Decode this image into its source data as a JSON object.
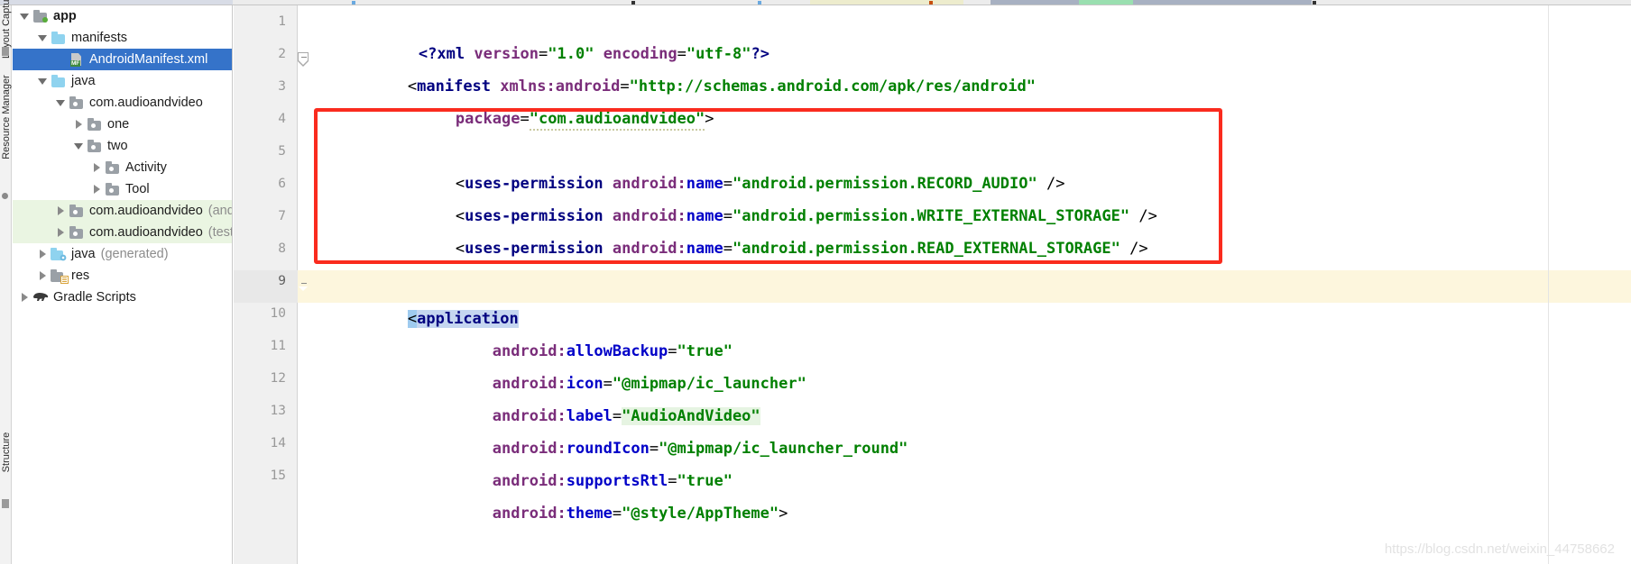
{
  "window": {
    "watermark": "https://blog.csdn.net/weixin_44758662"
  },
  "left_rail": {
    "items": [
      {
        "label": "Layout Captures",
        "name": "rail-item-1"
      },
      {
        "label": "Resource Manager",
        "name": "rail-item-resource-manager"
      },
      {
        "label": "Structure",
        "name": "rail-item-structure"
      }
    ]
  },
  "project_tree": {
    "items": [
      {
        "label": "app",
        "suffix": "",
        "icon": "module-folder-icon",
        "indent": 0,
        "twisty": "down",
        "selected": false,
        "bold": true,
        "greenbg": false
      },
      {
        "label": "manifests",
        "suffix": "",
        "icon": "folder-icon",
        "indent": 1,
        "twisty": "down",
        "selected": false,
        "bold": false,
        "greenbg": false
      },
      {
        "label": "AndroidManifest.xml",
        "suffix": "",
        "icon": "manifest-file-icon",
        "indent": 2,
        "twisty": "none",
        "selected": true,
        "bold": false,
        "greenbg": false
      },
      {
        "label": "java",
        "suffix": "",
        "icon": "folder-icon",
        "indent": 1,
        "twisty": "down",
        "selected": false,
        "bold": false,
        "greenbg": false
      },
      {
        "label": "com.audioandvideo",
        "suffix": "",
        "icon": "package-icon",
        "indent": 2,
        "twisty": "down",
        "selected": false,
        "bold": false,
        "greenbg": false
      },
      {
        "label": "one",
        "suffix": "",
        "icon": "package-icon",
        "indent": 3,
        "twisty": "right",
        "selected": false,
        "bold": false,
        "greenbg": false
      },
      {
        "label": "two",
        "suffix": "",
        "icon": "package-icon",
        "indent": 3,
        "twisty": "down",
        "selected": false,
        "bold": false,
        "greenbg": false
      },
      {
        "label": "Activity",
        "suffix": "",
        "icon": "package-icon",
        "indent": 4,
        "twisty": "right",
        "selected": false,
        "bold": false,
        "greenbg": false
      },
      {
        "label": "Tool",
        "suffix": "",
        "icon": "package-icon",
        "indent": 4,
        "twisty": "right",
        "selected": false,
        "bold": false,
        "greenbg": false
      },
      {
        "label": "com.audioandvideo",
        "suffix": "(andro",
        "icon": "package-icon",
        "indent": 2,
        "twisty": "right",
        "selected": false,
        "bold": false,
        "greenbg": true
      },
      {
        "label": "com.audioandvideo",
        "suffix": "(test)",
        "icon": "package-icon",
        "indent": 2,
        "twisty": "right",
        "selected": false,
        "bold": false,
        "greenbg": true
      },
      {
        "label": "java",
        "suffix": "(generated)",
        "icon": "generated-folder-icon",
        "indent": 1,
        "twisty": "right",
        "selected": false,
        "bold": false,
        "greenbg": false
      },
      {
        "label": "res",
        "suffix": "",
        "icon": "res-folder-icon",
        "indent": 1,
        "twisty": "right",
        "selected": false,
        "bold": false,
        "greenbg": false
      },
      {
        "label": "Gradle Scripts",
        "suffix": "",
        "icon": "gradle-elephant-icon",
        "indent": 0,
        "twisty": "right",
        "selected": false,
        "bold": false,
        "greenbg": false
      }
    ]
  },
  "editor": {
    "file": "AndroidManifest.xml",
    "line_numbers": [
      "1",
      "2",
      "3",
      "4",
      "5",
      "6",
      "7",
      "8",
      "9",
      "10",
      "11",
      "12",
      "13",
      "14",
      "15"
    ],
    "current_line": "9",
    "lines": [
      {
        "num": "1",
        "text": "<?xml version=\"1.0\" encoding=\"utf-8\"?>"
      },
      {
        "num": "2",
        "text": "<manifest xmlns:android=\"http://schemas.android.com/apk/res/android\""
      },
      {
        "num": "3",
        "text": "    package=\"com.audioandvideo\">"
      },
      {
        "num": "4",
        "text": ""
      },
      {
        "num": "5",
        "text": "    <uses-permission android:name=\"android.permission.RECORD_AUDIO\" />"
      },
      {
        "num": "6",
        "text": "    <uses-permission android:name=\"android.permission.WRITE_EXTERNAL_STORAGE\" />"
      },
      {
        "num": "7",
        "text": "    <uses-permission android:name=\"android.permission.READ_EXTERNAL_STORAGE\" />"
      },
      {
        "num": "8",
        "text": ""
      },
      {
        "num": "9",
        "text": "<application"
      },
      {
        "num": "10",
        "text": "        android:allowBackup=\"true\""
      },
      {
        "num": "11",
        "text": "        android:icon=\"@mipmap/ic_launcher\""
      },
      {
        "num": "12",
        "text": "        android:label=\"AudioAndVideo\""
      },
      {
        "num": "13",
        "text": "        android:roundIcon=\"@mipmap/ic_launcher_round\""
      },
      {
        "num": "14",
        "text": "        android:supportsRtl=\"true\""
      },
      {
        "num": "15",
        "text": "        android:theme=\"@style/AppTheme\">"
      }
    ],
    "tokens": {
      "l1_open": "<?",
      "l1_name": "xml",
      "l1_attr1": "version",
      "l1_eq": "=",
      "l1_val1": "\"1.0\"",
      "l1_attr2": "encoding",
      "l1_val2": "\"utf-8\"",
      "l1_close": "?>",
      "l2_lt": "<",
      "l2_tag": "manifest",
      "l2_attr": "xmlns:android",
      "l2_eq": "=",
      "l2_val": "\"http://schemas.android.com/apk/res/android\"",
      "l3_attr": "package",
      "l3_eq": "=",
      "l3_val": "\"com.audioandvideo\"",
      "l3_gt": ">",
      "perm_lt": "<",
      "perm_tag": "uses-permission",
      "perm_ns": "android",
      "perm_colon": ":",
      "perm_attr": "name",
      "perm_eq": "=",
      "perm_end": "/>",
      "perm1_val": "\"android.permission.RECORD_AUDIO\"",
      "perm2_val": "\"android.permission.WRITE_EXTERNAL_STORAGE\"",
      "perm3_val": "\"android.permission.READ_EXTERNAL_STORAGE\"",
      "app_lt": "<",
      "app_tag": "application",
      "a_ns": "android",
      "a_colon": ":",
      "a_eq": "=",
      "a10_name": "allowBackup",
      "a10_val": "\"true\"",
      "a11_name": "icon",
      "a11_val": "\"@mipmap/ic_launcher\"",
      "a12_name": "label",
      "a12_val": "\"AudioAndVideo\"",
      "a13_name": "roundIcon",
      "a13_val": "\"@mipmap/ic_launcher_round\"",
      "a14_name": "supportsRtl",
      "a14_val": "\"true\"",
      "a15_name": "theme",
      "a15_val": "\"@style/AppTheme\"",
      "a15_gt": ">"
    }
  },
  "annotation": {
    "highlight_color": "#fa2b1e",
    "label": "red-highlight-box"
  },
  "colors": {
    "selection_blue": "#3573c9",
    "tag_navy": "#000080",
    "attr_purple": "#7a2d7a",
    "ns_blue": "#0000c8",
    "value_green": "#008000",
    "current_line_yellow": "#fdf6dd",
    "scope_green": "#eaf5e2"
  }
}
